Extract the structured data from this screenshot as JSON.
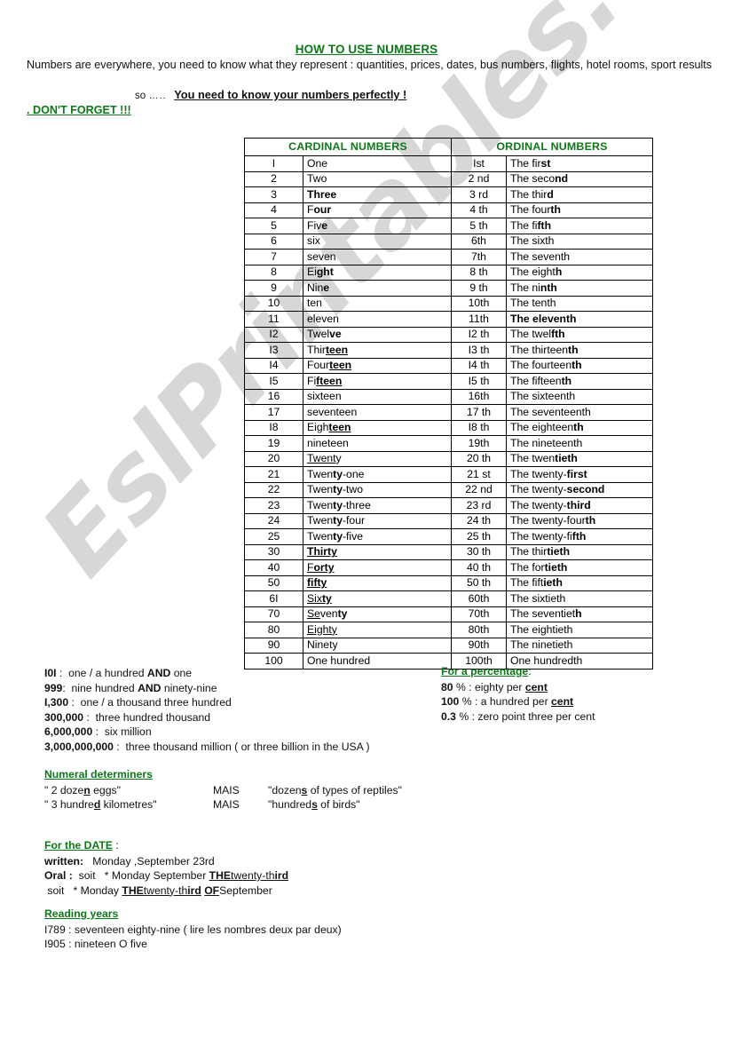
{
  "title": "HOW TO USE NUMBERS",
  "intro": "Numbers are everywhere, you need to know what they represent : quantities, prices, dates, bus numbers, flights, hotel rooms, sport results",
  "so_prefix": "so",
  "so_dots": "…..",
  "so_emphasis": "You need to know your numbers perfectly !",
  "dont_forget": ". DON'T FORGET !!!",
  "table": {
    "headers": {
      "cardinal": "CARDINAL NUMBERS",
      "ordinal": "ORDINAL NUMBERS"
    },
    "rows": [
      {
        "n": "I",
        "word": "One",
        "on": "Ist",
        "oword": "The first",
        "wi": 0,
        "oi": 1
      },
      {
        "n": "2",
        "word": "Two",
        "on": "2 nd",
        "oword": "The second",
        "wi": 0,
        "oi": 0
      },
      {
        "n": "3",
        "word": "Three",
        "on": "3 rd",
        "oword": "The third",
        "wi": 1,
        "oi": 0
      },
      {
        "n": "4",
        "word": "Four",
        "on": "4 th",
        "oword": "The fourth",
        "wi": 0,
        "oi": 0
      },
      {
        "n": "5",
        "word": "Five",
        "on": "5 th",
        "oword": "The fifth",
        "wi": 0,
        "oi": 1
      },
      {
        "n": "6",
        "word": "six",
        "on": "6th",
        "oword": "The sixth",
        "wi": 0,
        "oi": 1
      },
      {
        "n": "7",
        "word": "seven",
        "on": "7th",
        "oword": "The seventh",
        "wi": 0,
        "oi": 1
      },
      {
        "n": "8",
        "word": "Eight",
        "on": "8 th",
        "oword": "The eighth",
        "wi": 0,
        "oi": 1
      },
      {
        "n": "9",
        "word": "Nine",
        "on": "9 th",
        "oword": "The ninth",
        "wi": 0,
        "oi": 0
      },
      {
        "n": "10",
        "word": "ten",
        "on": "10th",
        "oword": "The tenth",
        "wi": 1,
        "oi": 1
      },
      {
        "n": "11",
        "word": "eleven",
        "on": "11th",
        "oword": "The eleventh",
        "wi": 0,
        "oi": 2
      },
      {
        "n": "I2",
        "word": "Twelve",
        "on": "I2 th",
        "oword": "The twelfth",
        "wi": 2,
        "oi": 1
      },
      {
        "n": "I3",
        "word": "Thirteen",
        "on": "I3 th",
        "oword": "The thirteenth",
        "wi": 0,
        "oi": 1
      },
      {
        "n": "I4",
        "word": "Fourteen",
        "on": "I4 th",
        "oword": "The fourteenth",
        "wi": 0,
        "oi": 0
      },
      {
        "n": "I5",
        "word": "Fifteen",
        "on": "I5 th",
        "oword": "The fifteenth",
        "wi": 0,
        "oi": 1
      },
      {
        "n": "16",
        "word": "sixteen",
        "on": "16th",
        "oword": "The sixteenth",
        "wi": 0,
        "oi": 1
      },
      {
        "n": "17",
        "word": "seventeen",
        "on": "17 th",
        "oword": "The seventeenth",
        "wi": 0,
        "oi": 1
      },
      {
        "n": "I8",
        "word": "Eighteen",
        "on": "I8 th",
        "oword": "The eighteenth",
        "wi": 0,
        "oi": 0
      },
      {
        "n": "19",
        "word": "nineteen",
        "on": "19th",
        "oword": "The nineteenth",
        "wi": 0,
        "oi": 1
      },
      {
        "n": "20",
        "word": "Twenty",
        "on": "20 th",
        "oword": "The twentieth",
        "wi": 0,
        "oi": 0
      },
      {
        "n": "21",
        "word": "Twenty-one",
        "on": "21 st",
        "oword": "The twenty-first",
        "wi": 0,
        "oi": 1
      },
      {
        "n": "22",
        "word": "Twenty-two",
        "on": "22 nd",
        "oword": "The twenty-second",
        "wi": 0,
        "oi": 0
      },
      {
        "n": "23",
        "word": "Twenty-three",
        "on": "23 rd",
        "oword": "The twenty-third",
        "wi": 0,
        "oi": 0
      },
      {
        "n": "24",
        "word": "Twenty-four",
        "on": "24 th",
        "oword": "The twenty-fourth",
        "wi": 0,
        "oi": 1
      },
      {
        "n": "25",
        "word": "Twenty-five",
        "on": "25 th",
        "oword": "The twenty-fifth",
        "wi": 0,
        "oi": 0
      },
      {
        "n": "30",
        "word": "Thirty",
        "on": "30 th",
        "oword": "The thirtieth",
        "wi": 0,
        "oi": 1
      },
      {
        "n": "40",
        "word": "Forty",
        "on": "40 th",
        "oword": "The fortieth",
        "wi": 0,
        "oi": 0
      },
      {
        "n": "50",
        "word": "fifty",
        "on": "50 th",
        "oword": "The fiftieth",
        "wi": 0,
        "oi": 0
      },
      {
        "n": "6I",
        "word": "Sixty",
        "on": "60th",
        "oword": "The sixtieth",
        "wi": 0,
        "oi": 0
      },
      {
        "n": "70",
        "word": "Seventy",
        "on": "70th",
        "oword": "The seventieth",
        "wi": 0,
        "oi": 0
      },
      {
        "n": "80",
        "word": "Eighty",
        "on": "80th",
        "oword": "The eightieth",
        "wi": 0,
        "oi": 1
      },
      {
        "n": "90",
        "word": "Ninety",
        "on": "90th",
        "oword": "The ninetieth",
        "wi": 0,
        "oi": 1
      },
      {
        "n": "100",
        "word": "One hundred",
        "on": "100th",
        "oword": "One hundredth",
        "wi": 0,
        "oi": 0
      }
    ]
  },
  "big_numbers": {
    "rows": [
      {
        "num": "I0I",
        "sep": " :",
        "text_a": "one / a hundred ",
        "bold": "AND",
        "text_b": " one"
      },
      {
        "num": "999",
        "sep": ":",
        "text_a": "nine hundred ",
        "bold": "AND",
        "text_b": " ninety-nine"
      },
      {
        "num": "I,300",
        "sep": " :",
        "text_a": "one / a thousand three hundred",
        "bold": "",
        "text_b": ""
      },
      {
        "num": "300,000",
        "sep": " :",
        "text_a": "three hundred thousand",
        "bold": "",
        "text_b": ""
      },
      {
        "num": "6,000,000",
        "sep": " :",
        "text_a": "six million",
        "bold": "",
        "text_b": ""
      },
      {
        "num": "3,000,000,000",
        "sep": " :",
        "text_a": "three thousand million ( or three billion in the USA )",
        "bold": "",
        "text_b": ""
      }
    ]
  },
  "percentage": {
    "heading": "For a percentage",
    "heading_suffix": ":",
    "rows": [
      {
        "num": "80",
        "unit": "% :",
        "text": "eighty per ",
        "emph": "cent"
      },
      {
        "num": "100",
        "unit": "% :",
        "text": "a hundred per ",
        "emph": "cent"
      },
      {
        "num": "0.3",
        "unit": "% :",
        "text": "zero point three per cent",
        "emph": ""
      }
    ]
  },
  "determiners": {
    "heading": "Numeral determiners",
    "rows": [
      {
        "left_a": "\" 2 doze",
        "left_emph": "n",
        "left_b": "  eggs\"",
        "mid": "MAIS",
        "right_a": "\"dozen",
        "right_emph": "s",
        "right_b": " of types of reptiles\""
      },
      {
        "left_a": "\" 3  hundre",
        "left_emph": "d",
        "left_b": "  kilometres\"",
        "mid": "MAIS",
        "right_a": "\"hundred",
        "right_emph": "s",
        "right_b": " of birds\""
      }
    ]
  },
  "date": {
    "heading": "For the DATE",
    "heading_suffix": " :",
    "written_label": "written:",
    "written_value": "Monday ,September 23rd",
    "oral_label": "Oral :",
    "oral_soit": "soit",
    "oral_line1_a": "* Monday September ",
    "oral_line1_the": "THE",
    "oral_line1_b": "twenty-th",
    "oral_line1_c": "ird",
    "oral_line2_soit": "soit",
    "oral_line2_a": "* Monday ",
    "oral_line2_the": "THE",
    "oral_line2_b": "twenty-th",
    "oral_line2_c": "ird",
    "oral_line2_of": "OF",
    "oral_line2_d": "September"
  },
  "years": {
    "heading": "Reading years",
    "rows": [
      {
        "year": "I789 : seventeen eighty-nine  ( lire les nombres deux par deux)"
      },
      {
        "year": "I905 : nineteen O five"
      }
    ]
  },
  "watermark": "EslPrintables.com",
  "colors": {
    "green": "#0b7a16",
    "text": "#111111",
    "border": "#000000"
  }
}
